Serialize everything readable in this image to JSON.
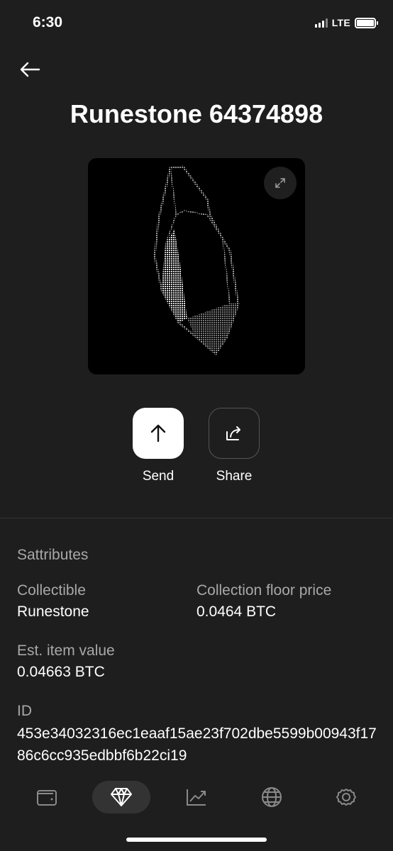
{
  "status_bar": {
    "time": "6:30",
    "network": "LTE"
  },
  "header": {
    "back_icon": "arrow-left-icon",
    "title": "Runestone 64374898"
  },
  "media": {
    "expand_icon": "expand-icon"
  },
  "actions": {
    "send": {
      "label": "Send",
      "icon": "arrow-up-icon"
    },
    "share": {
      "label": "Share",
      "icon": "share-icon"
    }
  },
  "details": {
    "section_title": "Sattributes",
    "collectible": {
      "label": "Collectible",
      "value": "Runestone"
    },
    "floor_price": {
      "label": "Collection floor price",
      "value": "0.0464 BTC"
    },
    "est_value": {
      "label": "Est. item value",
      "value": "0.04663 BTC"
    },
    "id": {
      "label": "ID",
      "value": "453e34032316ec1eaaf15ae23f702dbe5599b00943f1786c6cc935edbbf6b22ci19"
    }
  },
  "bottom_nav": [
    {
      "name": "wallet",
      "icon": "wallet-icon",
      "active": false
    },
    {
      "name": "collectibles",
      "icon": "diamond-icon",
      "active": true
    },
    {
      "name": "chart",
      "icon": "chart-icon",
      "active": false
    },
    {
      "name": "explore",
      "icon": "globe-icon",
      "active": false
    },
    {
      "name": "settings",
      "icon": "gear-icon",
      "active": false
    }
  ],
  "colors": {
    "background": "#1e1e1e",
    "muted_text": "#a8a8a8",
    "active_nav": "#333333"
  }
}
